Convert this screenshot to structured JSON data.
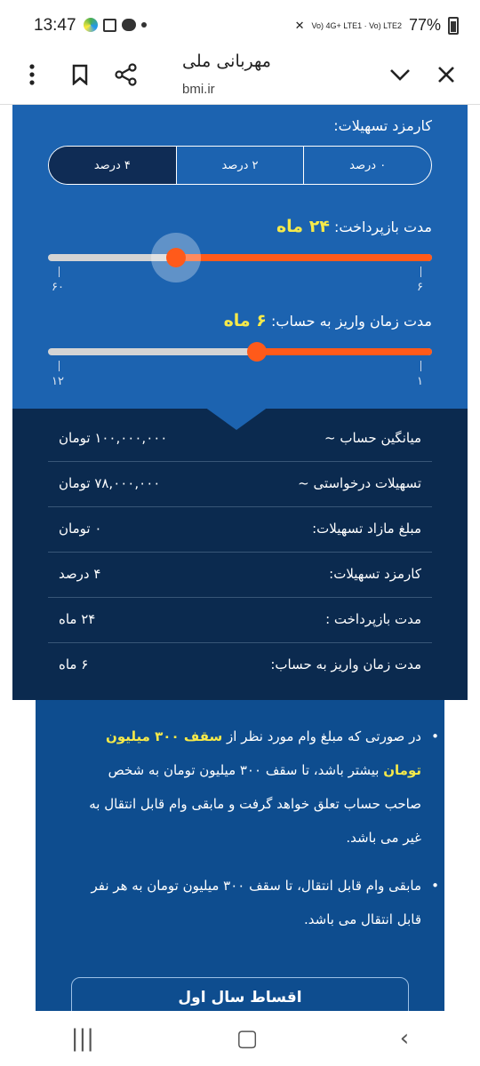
{
  "status_bar": {
    "time": "13:47",
    "battery": "77%",
    "network": "Vo) 4G+ LTE1 · Vo) LTE2"
  },
  "browser": {
    "title": "مهربانی ملی",
    "url": "bmi.ir"
  },
  "calculator": {
    "fee_label": "کارمزد تسهیلات:",
    "fee_options": [
      "۰ درصد",
      "۲ درصد",
      "۴ درصد"
    ],
    "fee_selected_index": 2,
    "repay_label": "مدت بازپرداخت:",
    "repay_value": "۲۴ ماه",
    "repay_min_label": "۶",
    "repay_max_label": "۶۰",
    "repay_level": 0.667,
    "deposit_label": "مدت زمان واریز به حساب:",
    "deposit_value": "۶ ماه",
    "deposit_min_label": "۱",
    "deposit_max_label": "۱۲",
    "deposit_level": 0.455
  },
  "results": [
    {
      "key": "میانگین حساب ~",
      "value": "۱۰۰,۰۰۰,۰۰۰ تومان"
    },
    {
      "key": "تسهیلات درخواستی ~",
      "value": "۷۸,۰۰۰,۰۰۰ تومان"
    },
    {
      "key": "مبلغ مازاد تسهیلات:",
      "value": "۰ تومان"
    },
    {
      "key": "کارمزد تسهیلات:",
      "value": "۴ درصد"
    },
    {
      "key": "مدت بازپرداخت :",
      "value": "۲۴ ماه"
    },
    {
      "key": "مدت زمان واریز به حساب:",
      "value": "۶ ماه"
    }
  ],
  "info": {
    "bullet1_pre": "در صورتی که مبلغ وام مورد نظر از ",
    "bullet1_highlight": "سقف ۳۰۰ میلیون تومان",
    "bullet1_post": " بیشتر باشد، تا سقف ۳۰۰ میلیون تومان به شخص صاحب حساب تعلق خواهد گرفت و مابقی وام قابل انتقال به غیر می باشد.",
    "bullet2": "مابقی وام قابل انتقال، تا سقف ۳۰۰ میلیون تومان به هر نفر قابل انتقال می باشد.",
    "button_label": "اقساط سال اول"
  }
}
